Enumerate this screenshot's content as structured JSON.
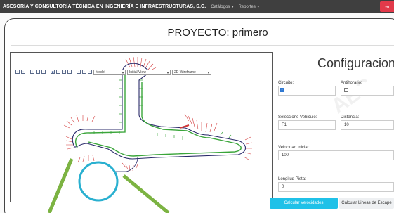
{
  "navbar": {
    "brand": "ASESORÍA Y CONSULTORÍA TÉCNICA EN INGENIERÍA E INFRAESTRUCTURAS, S.C.",
    "menus": [
      "Catálogos",
      "Reportes"
    ],
    "caret": "▾",
    "logout_icon": "sign-out-icon",
    "logout_glyph": "⇥",
    "colors": {
      "bar": "#3f3f3f",
      "logout": "#e23a4a"
    }
  },
  "page": {
    "title": "PROYECTO: primero"
  },
  "viewer": {
    "toolbar": {
      "icons": [
        {
          "name": "save-icon",
          "glyph": "▪"
        },
        {
          "name": "print-icon",
          "glyph": "▪"
        },
        {
          "name": "zoom-in-icon",
          "glyph": "+"
        },
        {
          "name": "zoom-out-icon",
          "glyph": "−"
        },
        {
          "name": "zoom-window-icon",
          "glyph": "▫"
        },
        {
          "name": "zoom-extents-icon",
          "glyph": "■"
        },
        {
          "name": "pan-icon",
          "glyph": "▫"
        },
        {
          "name": "rotate-icon",
          "glyph": "▫"
        },
        {
          "name": "measure-icon",
          "glyph": "▫"
        },
        {
          "name": "layers-icon",
          "glyph": "▫"
        },
        {
          "name": "properties-icon",
          "glyph": "▫"
        },
        {
          "name": "settings-icon",
          "glyph": "▫"
        }
      ],
      "selects": [
        "Model",
        "Initial View",
        "2D Wireframe"
      ],
      "chevron": "▾"
    }
  },
  "config": {
    "title": "Configuracion",
    "circuito_label": "Circuito:",
    "circuito_checked": true,
    "check_glyph": "✓",
    "antihorario_label": "Antihorario:",
    "antihorario_checked": false,
    "vehiculo_label": "Seleccione Vehiculo:",
    "vehiculo_value": "F1",
    "distancia_label": "Distancia:",
    "distancia_value": "10",
    "velocidad_label": "Velocidad Inicial:",
    "velocidad_value": "100",
    "longitud_label": "Longitud Pista:",
    "longitud_value": "0",
    "btn_velocidades": "Calcular Velocidades",
    "btn_lineas": "Calcular Lineas de Escape",
    "colors": {
      "primary": "#1fc1e8",
      "secondary": "#eef0f2"
    }
  },
  "watermark": "AEC"
}
